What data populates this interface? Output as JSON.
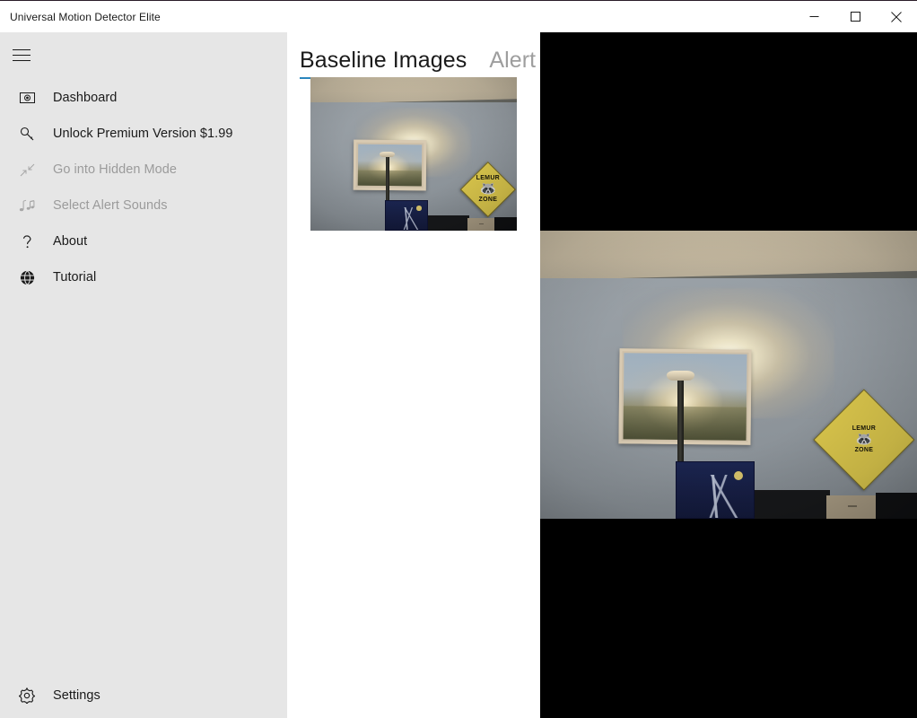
{
  "window": {
    "title": "Universal Motion Detector Elite",
    "controls": {
      "minimize": "minimize",
      "maximize": "maximize",
      "close": "close"
    }
  },
  "sidebar": {
    "menu_toggle": "hamburger-menu",
    "items": [
      {
        "label": "Dashboard",
        "icon": "camera-icon",
        "enabled": true
      },
      {
        "label": "Unlock Premium Version $1.99",
        "icon": "key-icon",
        "enabled": true
      },
      {
        "label": "Go into Hidden Mode",
        "icon": "collapse-arrows-icon",
        "enabled": false
      },
      {
        "label": "Select Alert Sounds",
        "icon": "music-notes-icon",
        "enabled": false
      },
      {
        "label": "About",
        "icon": "question-mark-icon",
        "enabled": true
      },
      {
        "label": "Tutorial",
        "icon": "globe-icon",
        "enabled": true
      }
    ],
    "bottom_item": {
      "label": "Settings",
      "icon": "gear-icon",
      "enabled": true
    }
  },
  "main": {
    "tabs": [
      {
        "label": "Baseline Images",
        "active": true
      },
      {
        "label": "Alert Im",
        "active": false
      }
    ],
    "baseline_thumbnail": {
      "alt": "baseline room photo with floor lamp, framed painting and lemur zone sign",
      "sign_top_text": "LEMUR",
      "sign_bottom_text": "ZONE",
      "sign_glyph": "🦝"
    }
  },
  "overlay": {
    "name": "expanded-image-viewer",
    "background_color": "#000000",
    "photo": {
      "alt": "enlarged room photo with floor lamp, framed painting and lemur zone sign",
      "sign_top_text": "LEMUR",
      "sign_bottom_text": "ZONE",
      "sign_glyph": "🦝"
    }
  },
  "colors": {
    "sidebar_background": "#e6e6e6",
    "content_background": "#ffffff",
    "tab_accent": "#2b86bd",
    "text_primary": "#1a1a1a",
    "text_disabled": "#9b9b9b"
  }
}
